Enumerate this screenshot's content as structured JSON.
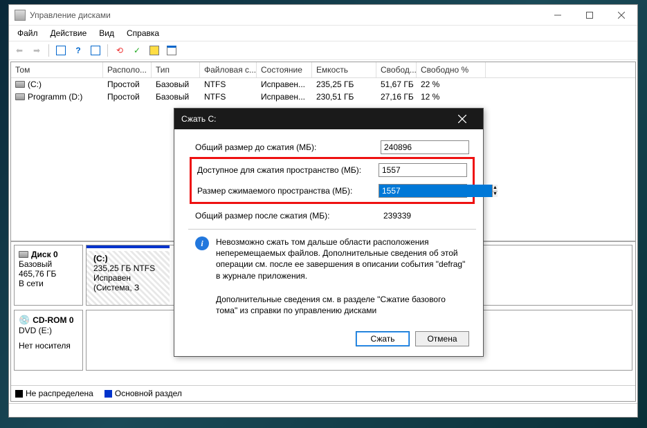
{
  "window": {
    "title": "Управление дисками",
    "menu": {
      "file": "Файл",
      "action": "Действие",
      "view": "Вид",
      "help": "Справка"
    }
  },
  "columns": {
    "vol": "Том",
    "loc": "Располо...",
    "typ": "Тип",
    "fs": "Файловая с...",
    "st": "Состояние",
    "cap": "Емкость",
    "fr": "Свобод...",
    "frp": "Свободно %"
  },
  "volumes": [
    {
      "name": "(C:)",
      "layout": "Простой",
      "type": "Базовый",
      "fs": "NTFS",
      "status": "Исправен...",
      "capacity": "235,25 ГБ",
      "free": "51,67 ГБ",
      "freepct": "22 %"
    },
    {
      "name": "Programm (D:)",
      "layout": "Простой",
      "type": "Базовый",
      "fs": "NTFS",
      "status": "Исправен...",
      "capacity": "230,51 ГБ",
      "free": "27,16 ГБ",
      "freepct": "12 %"
    }
  ],
  "disk0": {
    "title": "Диск 0",
    "type": "Базовый",
    "size": "465,76 ГБ",
    "status": "В сети",
    "part": {
      "name": "(C:)",
      "line2": "235,25 ГБ NTFS",
      "line3": "Исправен (Система, З"
    }
  },
  "cdrom": {
    "title": "CD-ROM 0",
    "line2": "DVD (E:)",
    "status": "Нет носителя"
  },
  "legend": {
    "unalloc": "Не распределена",
    "primary": "Основной раздел"
  },
  "dialog": {
    "title": "Сжать C:",
    "f1_label": "Общий размер до сжатия (МБ):",
    "f1_val": "240896",
    "f2_label": "Доступное для сжатия пространство (МБ):",
    "f2_val": "1557",
    "f3_label": "Размер сжимаемого пространства (МБ):",
    "f3_val": "1557",
    "f4_label": "Общий размер после сжатия (МБ):",
    "f4_val": "239339",
    "info1": "Невозможно сжать том дальше области расположения неперемещаемых файлов. Дополнительные сведения об этой операции см. после ее завершения в описании события \"defrag\" в журнале приложения.",
    "info2": "Дополнительные сведения см. в разделе \"Сжатие базового тома\" из справки по управлению дисками",
    "ok": "Сжать",
    "cancel": "Отмена"
  }
}
